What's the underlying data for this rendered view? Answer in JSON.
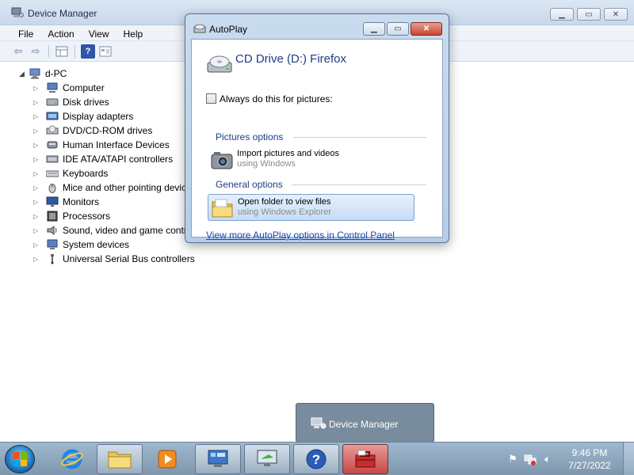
{
  "device_manager": {
    "title": "Device Manager",
    "menu": [
      "File",
      "Action",
      "View",
      "Help"
    ],
    "tree_root": "d-PC",
    "tree_items": [
      "Computer",
      "Disk drives",
      "Display adapters",
      "DVD/CD-ROM drives",
      "Human Interface Devices",
      "IDE ATA/ATAPI controllers",
      "Keyboards",
      "Mice and other pointing devices",
      "Monitors",
      "Processors",
      "Sound, video and game controllers",
      "System devices",
      "Universal Serial Bus controllers"
    ]
  },
  "autoplay": {
    "title": "AutoPlay",
    "drive_title": "CD Drive (D:) Firefox",
    "checkbox_label": "Always do this for pictures:",
    "section_pictures": "Pictures options",
    "option_import_title": "Import pictures and videos",
    "option_import_sub": "using Windows",
    "section_general": "General options",
    "option_open_title": "Open folder to view files",
    "option_open_sub": "using Windows Explorer",
    "link": "View more AutoPlay options in Control Panel"
  },
  "taskbar": {
    "time": "9:46 PM",
    "date": "7/27/2022",
    "preview_label": "Device Manager"
  }
}
